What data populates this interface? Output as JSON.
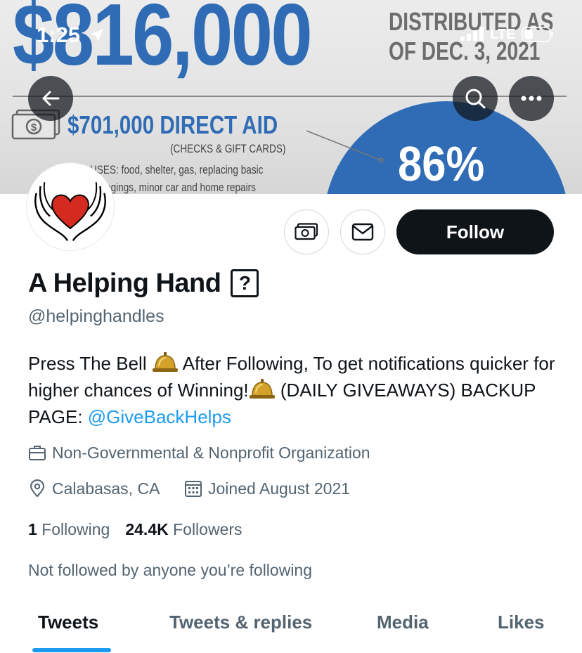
{
  "status_bar": {
    "time": "1:25",
    "network": "LTE"
  },
  "banner": {
    "amount": "$816,000",
    "distributed_line1": "DISTRIBUTED AS",
    "distributed_line2": "OF DEC. 3, 2021",
    "direct_aid": "$701,000 DIRECT AID",
    "checks": "(CHECKS & GIFT CARDS)",
    "uses_line1": "USES: food, shelter, gas, replacing basic",
    "uses_line2": "ngings, minor car and home repairs",
    "percent": "86%",
    "accent_color": "#2f6cb5"
  },
  "header_buttons": {
    "back_icon": "arrow-left-icon",
    "search_icon": "search-icon",
    "more_icon": "more-dots-icon"
  },
  "profile": {
    "display_name": "A Helping Hand",
    "name_badge": "?",
    "handle": "@helpinghandles",
    "follow_label": "Follow",
    "tip_icon": "money-icon",
    "message_icon": "envelope-icon",
    "bio": {
      "part1": "Press The Bell ",
      "part2": " After Following, To get notifications quicker for higher chances of Winning!",
      "part3": " (DAILY GIVEAWAYS) BACKUP PAGE: ",
      "mention": "@GiveBackHelps"
    },
    "category": "Non-Governmental & Nonprofit Organization",
    "location": "Calabasas, CA",
    "joined": "Joined August 2021",
    "following_count": "1",
    "following_label": "Following",
    "followers_count": "24.4K",
    "followers_label": "Followers",
    "not_followed_text": "Not followed by anyone you’re following"
  },
  "tabs": [
    {
      "label": "Tweets",
      "active": true
    },
    {
      "label": "Tweets & replies",
      "active": false
    },
    {
      "label": "Media",
      "active": false
    },
    {
      "label": "Likes",
      "active": false
    }
  ],
  "colors": {
    "link": "#1d9bf0",
    "text_primary": "#0f1419",
    "text_secondary": "#536471"
  }
}
